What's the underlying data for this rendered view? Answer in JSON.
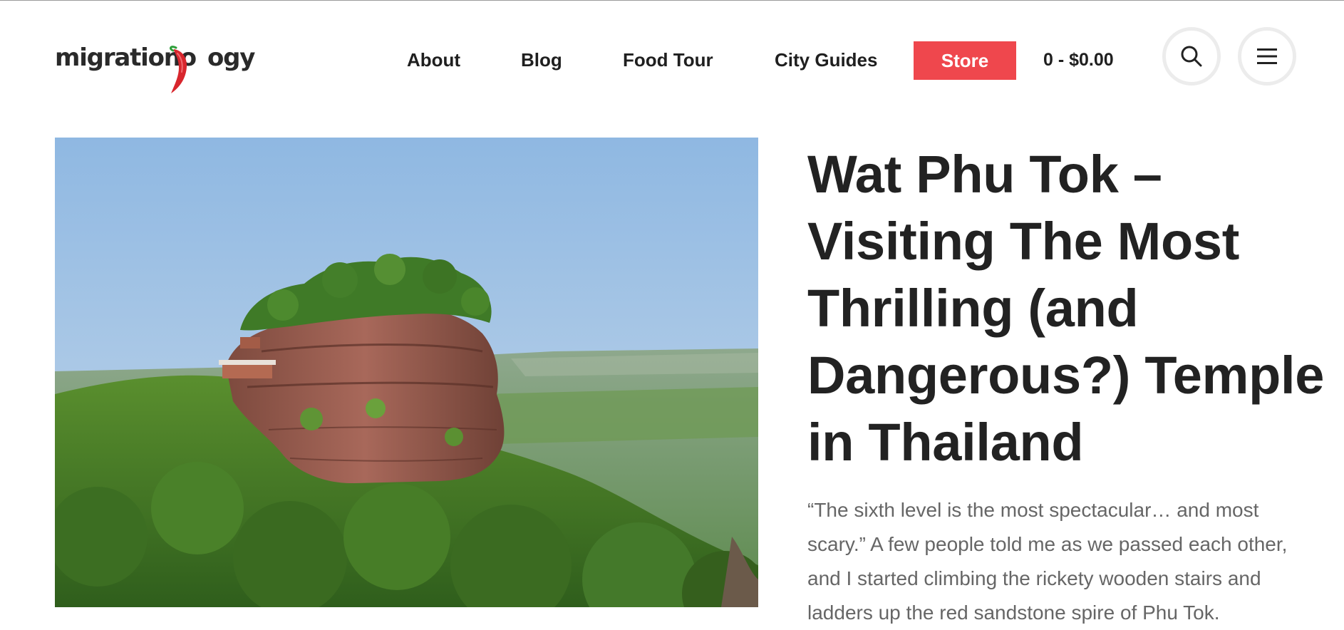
{
  "site": {
    "logo_text_left": "migrationo",
    "logo_text_right": "ogy"
  },
  "nav": {
    "items": [
      {
        "label": "About"
      },
      {
        "label": "Blog"
      },
      {
        "label": "Food Tour"
      },
      {
        "label": "City Guides"
      }
    ],
    "store_label": "Store",
    "cart_label": "0 - $0.00"
  },
  "icons": {
    "search": "search-icon",
    "menu": "hamburger-menu-icon",
    "logo_mark": "chili-pepper-icon"
  },
  "colors": {
    "accent": "#ef474d",
    "title": "#222222",
    "excerpt": "#666666"
  },
  "hero": {
    "subject": "sandstone-mountain-temple-photo"
  },
  "article": {
    "title": "Wat Phu Tok – Visiting The Most Thrilling (and Dangerous?) Temple in Thailand",
    "excerpt": "“The sixth level is the most spectacular… and most scary.” A few people told me as we passed each other, and I started climbing the rickety wooden stairs and ladders up the red sandstone spire of Phu Tok."
  }
}
